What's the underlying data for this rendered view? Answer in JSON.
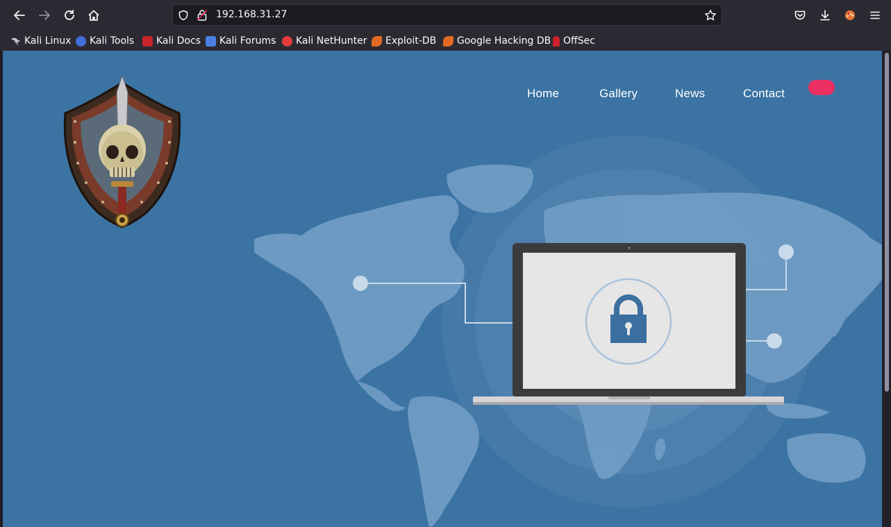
{
  "browser": {
    "url": "192.168.31.27",
    "bookmarks": [
      {
        "label": "Kali Linux",
        "icon": "kali-dragon-icon"
      },
      {
        "label": "Kali Tools",
        "icon": "kali-tools-icon"
      },
      {
        "label": "Kali Docs",
        "icon": "kali-docs-icon"
      },
      {
        "label": "Kali Forums",
        "icon": "kali-forums-icon"
      },
      {
        "label": "Kali NetHunter",
        "icon": "kali-nethunter-icon"
      },
      {
        "label": "Exploit-DB",
        "icon": "exploit-db-icon"
      },
      {
        "label": "Google Hacking DB",
        "icon": "exploit-db-icon"
      },
      {
        "label": "OffSec",
        "icon": "offsec-icon"
      }
    ]
  },
  "site": {
    "nav": [
      "Home",
      "Gallery",
      "News",
      "Contact"
    ],
    "colors": {
      "background": "#3b73a3",
      "accent": "#ec2f63",
      "map": "#6f9cc4",
      "lock": "#3b6fa0"
    }
  }
}
